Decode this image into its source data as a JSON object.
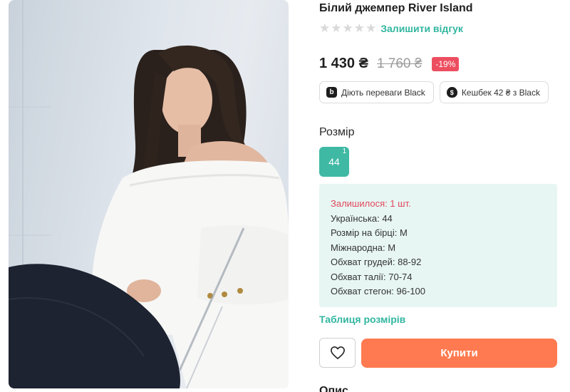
{
  "product": {
    "title": "Білий джемпер River Island",
    "rating_stars": 0,
    "review_link": "Залишити відгук",
    "price": "1 430 ₴",
    "old_price": "1 760 ₴",
    "discount": "-19%",
    "image_alt_subject": "model-in-white-off-shoulder-jumper"
  },
  "perks": [
    {
      "icon": "b",
      "label": "Діють переваги Black"
    },
    {
      "icon": "money-bag-icon",
      "label": "Кешбек 42 ₴ з Black"
    }
  ],
  "size": {
    "heading": "Розмір",
    "options": [
      {
        "label": "44",
        "qty": "1",
        "selected": true
      }
    ]
  },
  "details": {
    "remaining": "Залишилося: 1 шт.",
    "ukrainian": "Українська: 44",
    "tag_size": "Розмір на бірці: M",
    "international": "Міжнародна: M",
    "chest": "Обхват грудей: 88-92",
    "waist": "Обхват талії: 70-74",
    "hips": "Обхват стегон: 96-100"
  },
  "size_table_link": "Таблиця розмірів",
  "buy_label": "Купити",
  "description_heading": "Опис",
  "colors": {
    "accent": "#32b6a0",
    "size_selected": "#3fb9a4",
    "buy": "#ff7a50",
    "discount": "#ec4e60",
    "details_bg": "#e7f6f3",
    "warn": "#e2475b"
  }
}
